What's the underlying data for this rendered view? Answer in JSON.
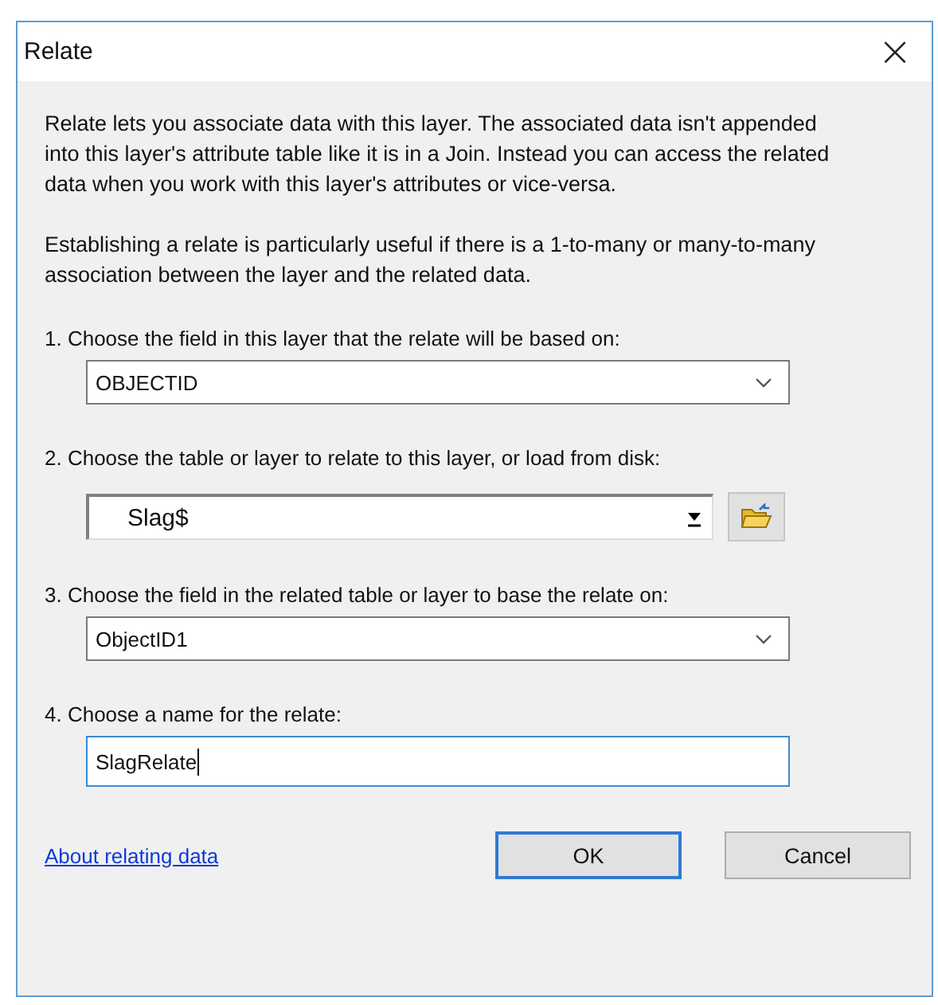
{
  "window": {
    "title": "Relate",
    "close": "×"
  },
  "paragraphs": [
    "Relate lets you associate data with this layer. The associated data isn't appended into this layer's attribute table like it is in a Join. Instead you can access the related data when you work with this layer's attributes or vice-versa.",
    "Establishing a relate is particularly useful if there is a 1-to-many or many-to-many association between the layer and the related data."
  ],
  "steps": [
    {
      "label": "1. Choose the field in this layer that the relate will be based on:",
      "kind": "dropdown",
      "value": "OBJECTID",
      "focused": false
    },
    {
      "label": "2. Choose the table or layer to relate to this layer, or load from disk:",
      "kind": "combo-browse",
      "value": "Slag$",
      "focused": false
    },
    {
      "label": "3. Choose the field in the related table or layer to base the relate on:",
      "kind": "dropdown",
      "value": "ObjectID1",
      "focused": false
    },
    {
      "label": "4. Choose a name for the relate:",
      "kind": "text",
      "value": "SlagRelate",
      "focused": true
    }
  ],
  "link": "About relating data",
  "buttons": [
    {
      "label": "OK",
      "default": true
    },
    {
      "label": "Cancel",
      "default": false
    }
  ]
}
